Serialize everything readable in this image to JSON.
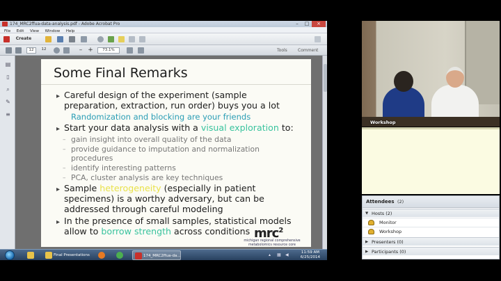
{
  "acrobat": {
    "window_title": "174_MRC2ffua-data-analysis.pdf - Adobe Acrobat Pro",
    "menus": [
      "File",
      "Edit",
      "View",
      "Window",
      "Help"
    ],
    "create_label": "Create",
    "page_current": "12",
    "page_total": "12",
    "zoom": "73.1%",
    "tools_label": "Tools",
    "comment_label": "Comment"
  },
  "slide": {
    "title": "Some Final Remarks",
    "b1_line1": "Careful design of the experiment (sample",
    "b1_line2": "preparation, extraction, run order) buys you a lot",
    "b1_note": "Randomization and blocking are your friends",
    "b2_pre": "Start your data analysis with a ",
    "b2_hl": "visual exploration",
    "b2_post": " to:",
    "sub1": "gain insight into overall quality of the data",
    "sub2a": "provide guidance to imputation and normalization",
    "sub2b": "procedures",
    "sub3": "identify interesting patterns",
    "sub4": "PCA, cluster analysis are key techniques",
    "b3_pre": "Sample ",
    "b3_hl": "heterogeneity",
    "b3_post": " (especially in patient",
    "b3_line2": "specimens) is a worthy adversary, but can be",
    "b3_line3": "addressed through careful modeling",
    "b4_line1": "In the presence of small samples, statistical models",
    "b4_pre": "allow to ",
    "b4_hl": "borrow strength",
    "b4_post": " across conditions",
    "logo": "mrc",
    "logo_sup": "2",
    "logo_sub": "michigan regional comprehensive metabolomics resource core"
  },
  "taskbar": {
    "items": [
      "Final Presentations",
      "174_MRC2ffua-da..."
    ],
    "time": "11:59 AM",
    "date": "6/25/2014"
  },
  "video": {
    "label": "Workshop"
  },
  "attendees": {
    "title": "Attendees",
    "count": "(2)",
    "hosts_label": "Hosts (2)",
    "hosts": [
      "Monitor",
      "Workshop"
    ],
    "presenters_label": "Presenters (0)",
    "participants_label": "Participants (0)"
  },
  "colors": {
    "highlight_green": "#39c39e",
    "highlight_yellow": "#e9e24a",
    "note_blue": "#2a9db5"
  }
}
